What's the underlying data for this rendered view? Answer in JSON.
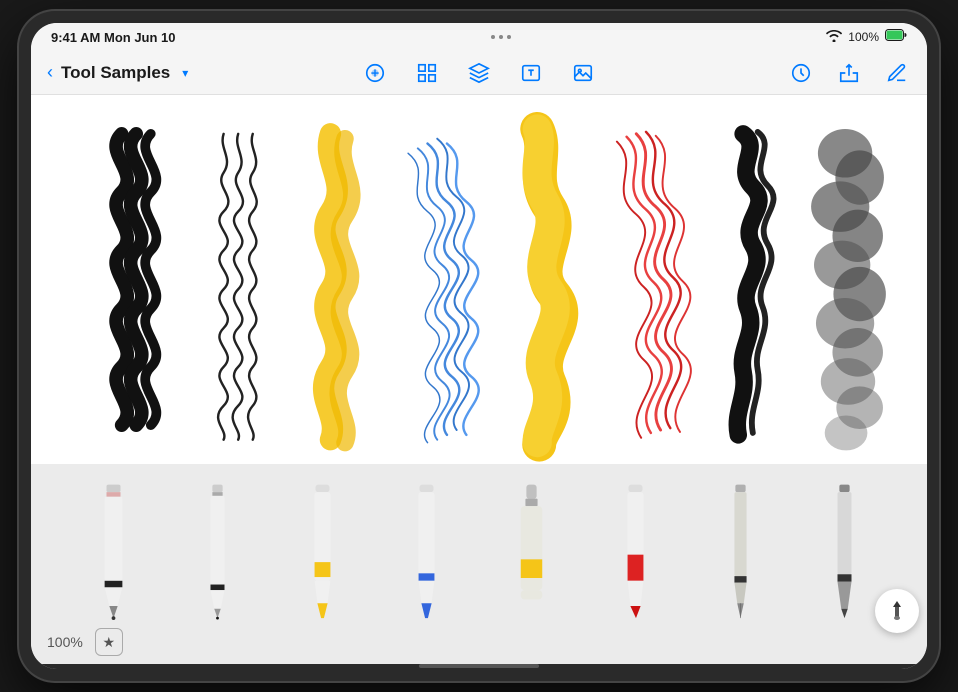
{
  "status_bar": {
    "time": "9:41 AM",
    "date": "Mon Jun 10",
    "wifi": "WiFi",
    "battery": "100%"
  },
  "toolbar": {
    "back_label": "",
    "title": "Tool Samples",
    "title_chevron": "▾"
  },
  "toolbar_icons": {
    "pencil_icon": "pencil",
    "grid_icon": "grid",
    "layers_icon": "layers",
    "text_icon": "text",
    "image_icon": "image",
    "timer_icon": "timer",
    "share_icon": "share",
    "edit_icon": "edit"
  },
  "canvas": {
    "background": "#ffffff"
  },
  "tools": [
    {
      "id": "pencil",
      "color": "#222222",
      "accent": "#222222"
    },
    {
      "id": "fine-liner",
      "color": "#222222",
      "accent": "#222222"
    },
    {
      "id": "marker-yellow",
      "color": "#f0c020",
      "accent": "#f0c020"
    },
    {
      "id": "marker-blue",
      "color": "#2255dd",
      "accent": "#2255dd"
    },
    {
      "id": "paint-tube",
      "color": "#e8e8e0",
      "accent": "#f0c020"
    },
    {
      "id": "crayon-red",
      "color": "#dd2222",
      "accent": "#dd2222"
    },
    {
      "id": "fountain-pen",
      "color": "#888888",
      "accent": "#222222"
    },
    {
      "id": "brush-dark",
      "color": "#555555",
      "accent": "#222222"
    }
  ],
  "bottom_bar": {
    "zoom": "100%",
    "star_label": "★"
  }
}
